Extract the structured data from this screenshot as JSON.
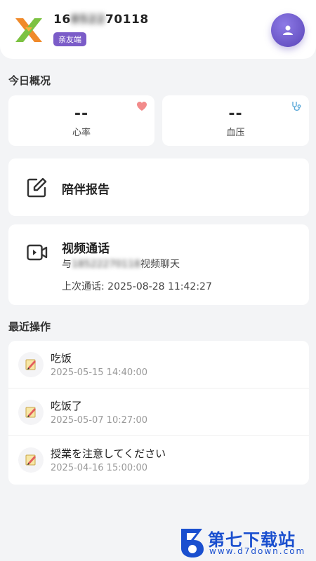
{
  "header": {
    "phone_visible": "16",
    "phone_blurred": "8522",
    "phone_tail": "70118",
    "badge": "亲友端"
  },
  "overview": {
    "title": "今日概况",
    "heart_rate": {
      "value": "--",
      "label": "心率"
    },
    "blood_pressure": {
      "value": "--",
      "label": "血压"
    }
  },
  "report": {
    "title": "陪伴报告"
  },
  "video": {
    "title": "视频通话",
    "desc_prefix": "与",
    "desc_blurred": "18522270118",
    "desc_suffix": "视频聊天",
    "last_call": "上次通话: 2025-08-28 11:42:27"
  },
  "recent": {
    "title": "最近操作",
    "items": [
      {
        "title": "吃饭",
        "time": "2025-05-15 14:40:00"
      },
      {
        "title": "吃饭了",
        "time": "2025-05-07 10:27:00"
      },
      {
        "title": "授業を注意してください",
        "time": "2025-04-16 15:00:00"
      }
    ]
  },
  "watermark": {
    "title": "第七下载站",
    "url": "www.d7down.com"
  }
}
